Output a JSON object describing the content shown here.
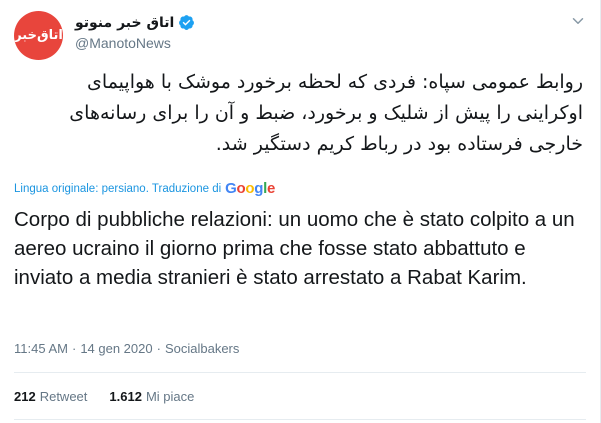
{
  "account": {
    "display_name": "اتاق خبر منوتو",
    "handle": "@ManotoNews",
    "avatar_text": "اتاق‌خبر"
  },
  "tweet": {
    "original_text": "روابط عمومی سپاه: فردی که لحظه برخورد موشک با هواپیمای اوکراینی را پیش از شلیک و برخورد، ضبط و آن را برای رسانه‌های خارجی فرستاده بود در رباط کریم دستگیر شد.",
    "translation_label": "Lingua originale: persiano. Traduzione di",
    "google_letters": [
      "G",
      "o",
      "o",
      "g",
      "l",
      "e"
    ],
    "translated_text": "Corpo di pubbliche relazioni: un uomo che è stato colpito a un aereo ucraino il giorno prima che fosse stato abbattuto e inviato a media stranieri è stato arrestato a Rabat Karim.",
    "time": "11:45 AM",
    "date": "14 gen 2020",
    "source": "Socialbakers"
  },
  "stats": {
    "retweets_count": "212",
    "retweets_label": "Retweet",
    "likes_count": "1.612",
    "likes_label": "Mi piace"
  },
  "colors": {
    "avatar_bg": "#e8453c",
    "verified": "#1da1f2",
    "link": "#1b95e0",
    "secondary_text": "#657786"
  }
}
